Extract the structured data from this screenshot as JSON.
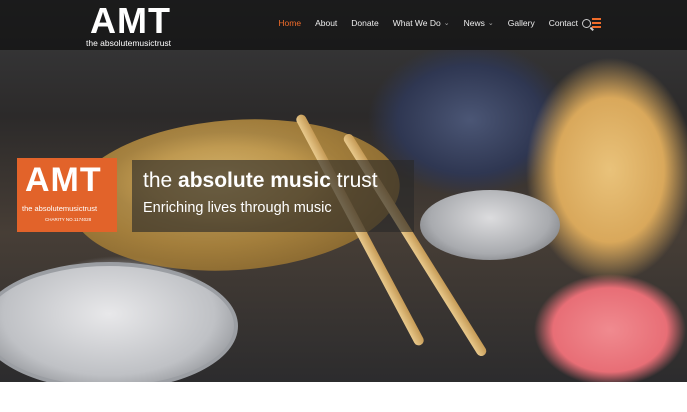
{
  "header": {
    "logo_title": "AMT",
    "logo_subtitle": "the absolutemusictrust",
    "nav": [
      {
        "label": "Home",
        "active": true
      },
      {
        "label": "About"
      },
      {
        "label": "Donate"
      },
      {
        "label": "What We Do",
        "dropdown": true
      },
      {
        "label": "News",
        "dropdown": true
      },
      {
        "label": "Gallery"
      },
      {
        "label": "Contact"
      }
    ],
    "icons": [
      "menu-icon",
      "search-icon"
    ],
    "accent_color": "#f06c2a"
  },
  "hero": {
    "badge": {
      "title": "AMT",
      "subtitle": "the absolutemusictrust",
      "charity": "CHARITY NO.1174028",
      "color": "#e2632a"
    },
    "tagline": {
      "prefix": "the ",
      "bold": "absolute music",
      "suffix": " trust",
      "subtitle": "Enriching lives through music"
    }
  }
}
